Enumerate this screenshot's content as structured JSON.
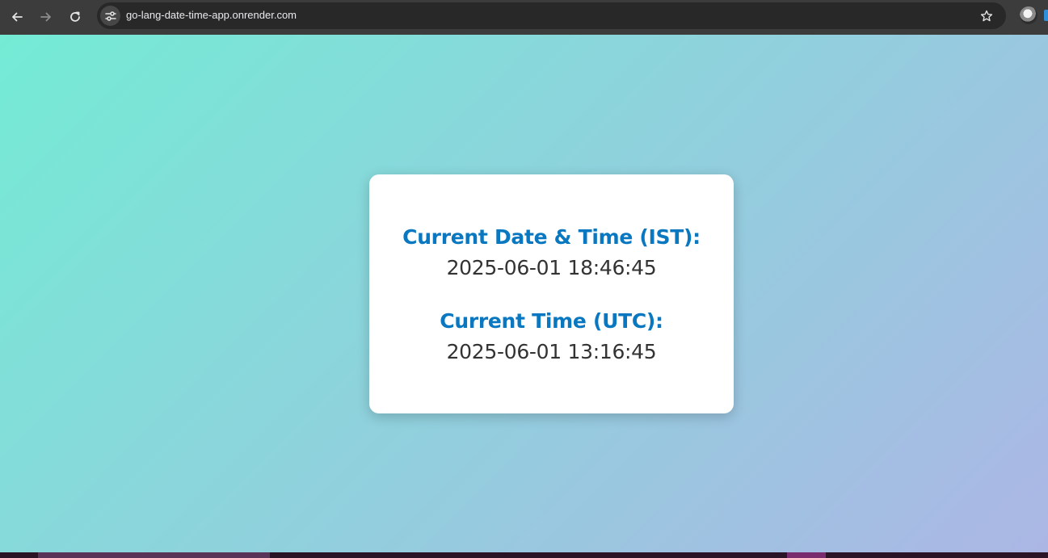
{
  "browser": {
    "url": "go-lang-date-time-app.onrender.com",
    "icons": {
      "back": "arrow-left-icon",
      "forward": "arrow-right-icon",
      "reload": "reload-icon",
      "site_info": "tune-icon",
      "bookmark": "star-icon"
    }
  },
  "card": {
    "ist_label": "Current Date & Time (IST):",
    "ist_value": "2025-06-01 18:46:45",
    "utc_label": "Current Time (UTC):",
    "utc_value": "2025-06-01 13:16:45"
  },
  "colors": {
    "gradient_start": "#74ebd5",
    "gradient_end": "#acb6e5",
    "label": "#0a78c0",
    "value": "#333333"
  }
}
